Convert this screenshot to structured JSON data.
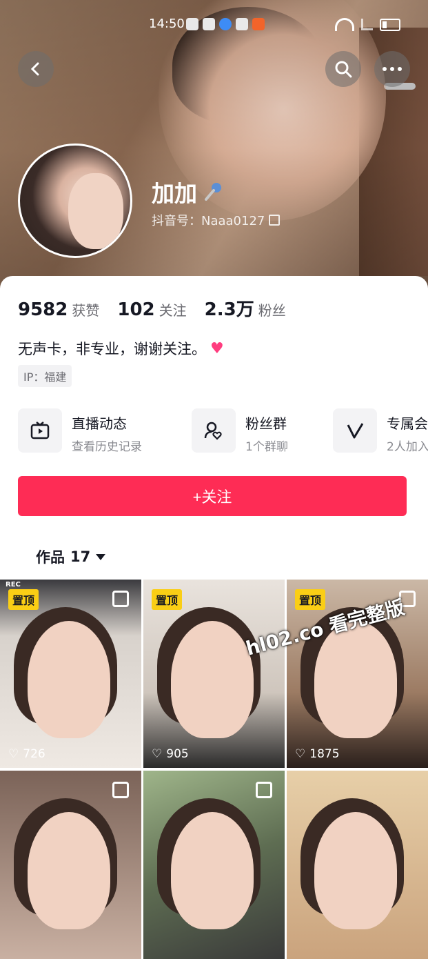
{
  "status_bar": {
    "time": "14:50"
  },
  "profile": {
    "name": "加加",
    "douyin_id": "抖音号：Naaa0127",
    "bio": "无声卡，非专业，谢谢关注。",
    "ip": "IP：福建"
  },
  "stats": [
    {
      "value": "9582",
      "label": "获赞"
    },
    {
      "value": "102",
      "label": "关注"
    },
    {
      "value": "2.3万",
      "label": "粉丝"
    }
  ],
  "features": [
    {
      "title": "直播动态",
      "subtitle": "查看历史记录",
      "icon": "tv-icon"
    },
    {
      "title": "粉丝群",
      "subtitle": "1个群聊",
      "icon": "fan-group-icon"
    },
    {
      "title": "专属会",
      "subtitle": "2人加入",
      "icon": "vip-v-icon"
    }
  ],
  "follow_button": "+关注",
  "works_tab": {
    "label": "作品",
    "count": "17"
  },
  "grid": [
    {
      "pinned": "置顶",
      "likes": "726",
      "rec": "REC"
    },
    {
      "pinned": "置顶",
      "likes": "905"
    },
    {
      "pinned": "置顶",
      "likes": "1875"
    },
    {},
    {},
    {}
  ],
  "watermark": "hl02.co 看完整版",
  "colors": {
    "accent": "#fe2c55",
    "pin": "#face15"
  }
}
